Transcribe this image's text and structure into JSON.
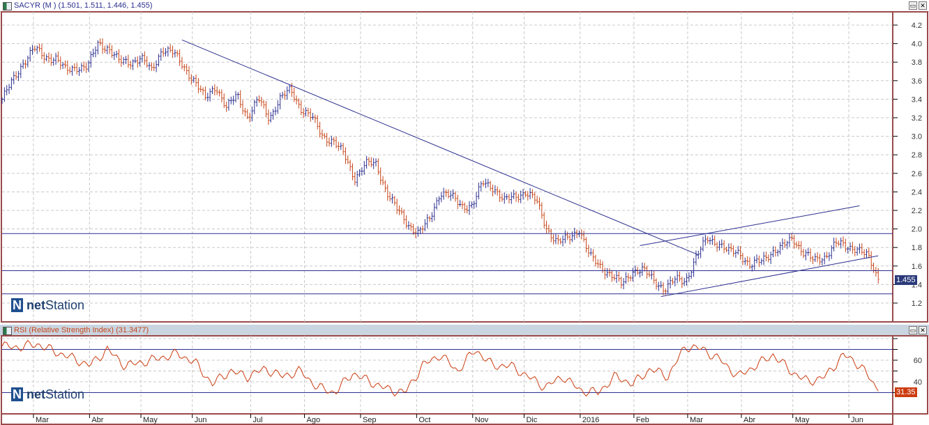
{
  "main_panel": {
    "title": "SACYR (M ) (1.501, 1.511, 1.446, 1.455)",
    "last_price_tag": "1.455",
    "logo": "netStation"
  },
  "rsi_panel": {
    "title": "RSI (Relative Strength Index) (31.3477)",
    "last_value_tag": "31.35",
    "logo": "netStation"
  },
  "window_buttons": {
    "maximize": "▭",
    "close": "✕"
  },
  "colors": {
    "up": "#2b2f8f",
    "down": "#c8461a",
    "line": "#2b2f8f",
    "rsi": "#cc3c10",
    "frame": "#9a4a4a",
    "tag_price": "#2b3a7a",
    "tag_rsi": "#cc3c10"
  },
  "chart_data": [
    {
      "type": "ohlc",
      "title": "SACYR (M )",
      "days": 376,
      "ylim": [
        1.1,
        4.3
      ],
      "yticks": [
        1.2,
        1.4,
        1.6,
        1.8,
        2.0,
        2.2,
        2.4,
        2.6,
        2.8,
        3.0,
        3.2,
        3.4,
        3.6,
        3.8,
        4.0,
        4.2
      ],
      "ytick_labels": [
        "1.2",
        "1.4",
        "1.6",
        "1.8",
        "2.0",
        "2.2",
        "2.4",
        "2.6",
        "2.8",
        "3.0",
        "3.2",
        "3.4",
        "3.6",
        "3.8",
        "4.0",
        "4.2"
      ],
      "weekly_closes": [
        3.4,
        3.6,
        3.8,
        3.95,
        3.85,
        3.85,
        3.7,
        3.75,
        3.75,
        4.0,
        3.95,
        3.8,
        3.8,
        3.85,
        3.7,
        3.95,
        3.9,
        3.75,
        3.6,
        3.4,
        3.55,
        3.3,
        3.45,
        3.2,
        3.4,
        3.2,
        3.4,
        3.5,
        3.3,
        3.2,
        3.0,
        2.95,
        2.8,
        2.55,
        2.7,
        2.7,
        2.4,
        2.2,
        2.05,
        1.95,
        2.1,
        2.4,
        2.35,
        2.25,
        2.25,
        2.5,
        2.45,
        2.3,
        2.35,
        2.4,
        2.3,
        2.0,
        1.85,
        1.9,
        2.0,
        1.7,
        1.6,
        1.5,
        1.4,
        1.55,
        1.55,
        1.45,
        1.35,
        1.45,
        1.45,
        1.7,
        1.9,
        1.85,
        1.75,
        1.75,
        1.6,
        1.65,
        1.75,
        1.8,
        1.9,
        1.75,
        1.65,
        1.7,
        1.85,
        1.8,
        1.8,
        1.7,
        1.455
      ],
      "horizontal_lines": [
        1.95,
        1.55,
        1.3
      ],
      "trendlines": [
        {
          "from": [
            77,
            4.04
          ],
          "to": [
            298,
            1.72
          ]
        },
        {
          "from": [
            273,
            1.82
          ],
          "to": [
            367,
            2.25
          ]
        },
        {
          "from": [
            282,
            1.27
          ],
          "to": [
            375,
            1.71
          ]
        }
      ],
      "last": 1.455
    },
    {
      "type": "line",
      "title": "RSI (Relative Strength Index)",
      "ylim": [
        17,
        88
      ],
      "yticks": [
        40,
        60
      ],
      "ytick_labels": [
        "40",
        "60"
      ],
      "horizontal_lines": [
        70,
        30
      ],
      "values": [
        73,
        72,
        75,
        68,
        62,
        55,
        70,
        55,
        58,
        62,
        66,
        58,
        38,
        50,
        45,
        52,
        45,
        50,
        35,
        30,
        48,
        40,
        33,
        30,
        55,
        65,
        50,
        70,
        55,
        55,
        45,
        35,
        45,
        32,
        30,
        45,
        38,
        52,
        45,
        73,
        70,
        60,
        45,
        55,
        65,
        50,
        40,
        45,
        65,
        55,
        31.35
      ],
      "last": 31.35
    }
  ],
  "x_axis": {
    "months": [
      {
        "label": "Mar",
        "day": 17
      },
      {
        "label": "Abr",
        "day": 41
      },
      {
        "label": "May",
        "day": 63
      },
      {
        "label": "Jun",
        "day": 85
      },
      {
        "label": "Jul",
        "day": 110
      },
      {
        "label": "Ago",
        "day": 133
      },
      {
        "label": "Sep",
        "day": 157
      },
      {
        "label": "Oct",
        "day": 181
      },
      {
        "label": "Nov",
        "day": 205
      },
      {
        "label": "Dic",
        "day": 227
      },
      {
        "label": "2016",
        "day": 251
      },
      {
        "label": "Feb",
        "day": 274
      },
      {
        "label": "Mar",
        "day": 297
      },
      {
        "label": "Abr",
        "day": 320
      },
      {
        "label": "May",
        "day": 342
      },
      {
        "label": "Jun",
        "day": 366
      }
    ]
  }
}
